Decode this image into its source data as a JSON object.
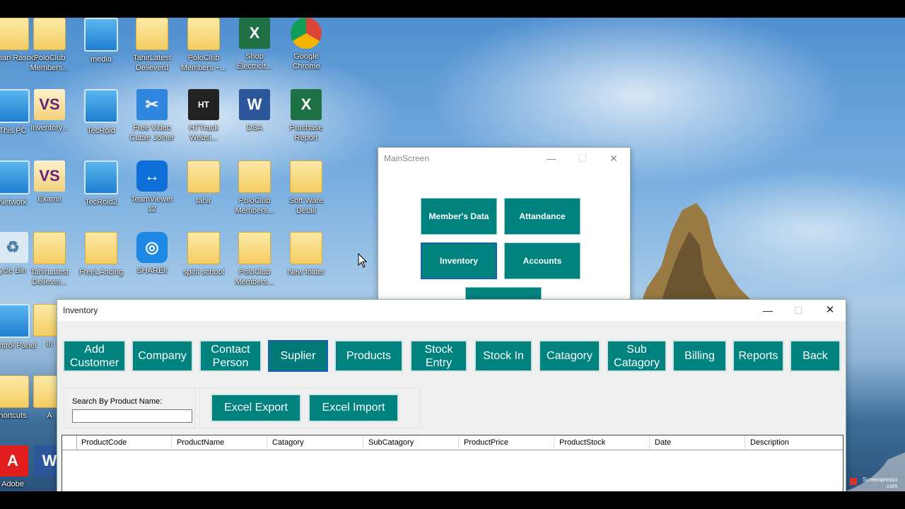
{
  "desktop": {
    "icons": [
      {
        "label": "Adnan Rasool",
        "icon": "user-folder-icon",
        "type": "folder"
      },
      {
        "label": "PoloClub Members...",
        "icon": "folder-icon",
        "type": "folder"
      },
      {
        "label": "media",
        "icon": "monitor-icon",
        "type": "monitor"
      },
      {
        "label": "TahirLatest Delieverd",
        "icon": "folder-icon",
        "type": "folder"
      },
      {
        "label": "PoloClub Members +...",
        "icon": "folder-icon",
        "type": "folder"
      },
      {
        "label": "Shop Electricit...",
        "icon": "excel-icon",
        "type": "excel"
      },
      {
        "label": "Google Chrome",
        "icon": "chrome-icon",
        "type": "chrome"
      },
      {
        "label": "This PC",
        "icon": "pc-icon",
        "type": "monitor"
      },
      {
        "label": "Inventory...",
        "icon": "visual-studio-icon",
        "type": "vs"
      },
      {
        "label": "TecRoid",
        "icon": "monitor-icon",
        "type": "monitor"
      },
      {
        "label": "Free Video Cutter Joiner",
        "icon": "video-cutter-icon",
        "type": "tool"
      },
      {
        "label": "HTTrack Websi...",
        "icon": "httrack-icon",
        "type": "ht"
      },
      {
        "label": "DSA",
        "icon": "word-icon",
        "type": "word"
      },
      {
        "label": "Purchase Report",
        "icon": "excel-icon",
        "type": "excel"
      },
      {
        "label": "Network",
        "icon": "network-icon",
        "type": "monitor"
      },
      {
        "label": "Exams",
        "icon": "visual-studio-icon",
        "type": "vs"
      },
      {
        "label": "TecRoid2",
        "icon": "monitor-icon",
        "type": "monitor"
      },
      {
        "label": "TeamViewer 12",
        "icon": "teamviewer-icon",
        "type": "tv"
      },
      {
        "label": "tahir",
        "icon": "folder-icon",
        "type": "folder"
      },
      {
        "label": "PoloClub Members...",
        "icon": "folder-icon",
        "type": "folder"
      },
      {
        "label": "Soft Ware Detail",
        "icon": "folder-icon",
        "type": "folder"
      },
      {
        "label": "ycle Bin",
        "icon": "recycle-bin-icon",
        "type": "recycle"
      },
      {
        "label": "TahirLatest Deliever...",
        "icon": "folder-icon",
        "type": "folder"
      },
      {
        "label": "FreeLAncing",
        "icon": "folder-icon",
        "type": "folder"
      },
      {
        "label": "SHAREit",
        "icon": "shareit-icon",
        "type": "share"
      },
      {
        "label": "spirit school",
        "icon": "folder-icon",
        "type": "folder"
      },
      {
        "label": "PoloClub Members...",
        "icon": "folder-icon",
        "type": "folder"
      },
      {
        "label": "New folder",
        "icon": "folder-icon",
        "type": "folder"
      },
      {
        "label": "Control Panel",
        "icon": "control-panel-icon",
        "type": "monitor"
      },
      {
        "label": "In",
        "icon": "folder-icon",
        "type": "folder"
      },
      {
        "label": "hortcuts",
        "icon": "shortcut-icon",
        "type": "folder"
      },
      {
        "label": "A",
        "icon": "folder-icon",
        "type": "folder"
      },
      {
        "label": "Adobe",
        "icon": "adobe-icon",
        "type": "adobe"
      },
      {
        "label": "",
        "icon": "word-icon",
        "type": "word"
      }
    ]
  },
  "main_screen": {
    "title": "MainScreen",
    "buttons": {
      "members_data": "Member's Data",
      "attandance": "Attandance",
      "inventory": "Inventory",
      "accounts": "Accounts"
    },
    "min": "—",
    "max": "☐",
    "close": "✕"
  },
  "inventory_window": {
    "title": "Inventory",
    "min": "—",
    "max": "☐",
    "close": "✕",
    "nav_buttons": [
      "Add Customer",
      "Company",
      "Contact Person",
      "Suplier",
      "Products",
      "Stock Entry",
      "Stock In",
      "Catagory",
      "Sub Catagory",
      "Billing",
      "Reports",
      "Back"
    ],
    "search_label": "Search By Product Name:",
    "search_value": "",
    "excel_export": "Excel Export",
    "excel_import": "Excel Import",
    "grid_columns": [
      "ProductCode",
      "ProductName",
      "Catagory",
      "SubCatagory",
      "ProductPrice",
      "ProductStock",
      "Date",
      "Description"
    ]
  },
  "watermark": {
    "line1": "Screenpresso",
    "line2": ".com"
  },
  "colors": {
    "accent": "#00827f",
    "active_border": "#1b5fb8"
  }
}
